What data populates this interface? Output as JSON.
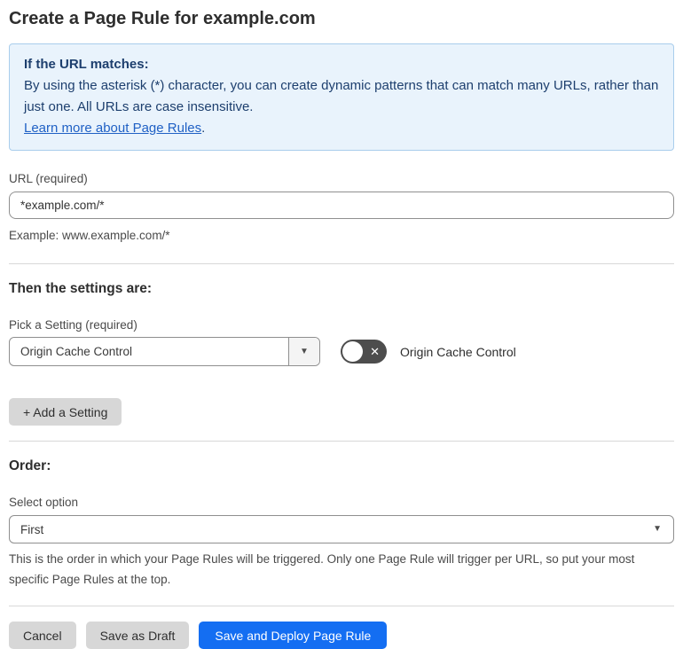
{
  "page": {
    "title": "Create a Page Rule for example.com"
  },
  "info_box": {
    "heading": "If the URL matches:",
    "body": "By using the asterisk (*) character, you can create dynamic patterns that can match many URLs, rather than just one. All URLs are case insensitive.",
    "link_label": "Learn more about Page Rules",
    "link_suffix": "."
  },
  "url_section": {
    "label": "URL (required)",
    "input_value": "*example.com/*",
    "help_text": "Example: www.example.com/*"
  },
  "settings_section": {
    "heading": "Then the settings are:",
    "picker_label": "Pick a Setting (required)",
    "selected_setting": "Origin Cache Control",
    "toggle_state": "off",
    "toggle_label": "Origin Cache Control",
    "add_setting_label": "+ Add a Setting"
  },
  "order_section": {
    "heading": "Order:",
    "select_label": "Select option",
    "selected_option": "First",
    "help_text": "This is the order in which your Page Rules will be triggered. Only one Page Rule will trigger per URL, so put your most specific Page Rules at the top."
  },
  "footer": {
    "cancel_label": "Cancel",
    "save_draft_label": "Save as Draft",
    "save_deploy_label": "Save and Deploy Page Rule"
  },
  "icons": {
    "caret_down": "▼",
    "toggle_x": "✕"
  },
  "colors": {
    "info_bg": "#e9f3fc",
    "info_border": "#a9cdec",
    "info_text": "#1d3f6e",
    "link_blue": "#2061c5",
    "primary_blue": "#146ef2",
    "button_gray": "#d7d7d7",
    "toggle_off_bg": "#4d4d4d",
    "divider": "#d8d8d8"
  }
}
